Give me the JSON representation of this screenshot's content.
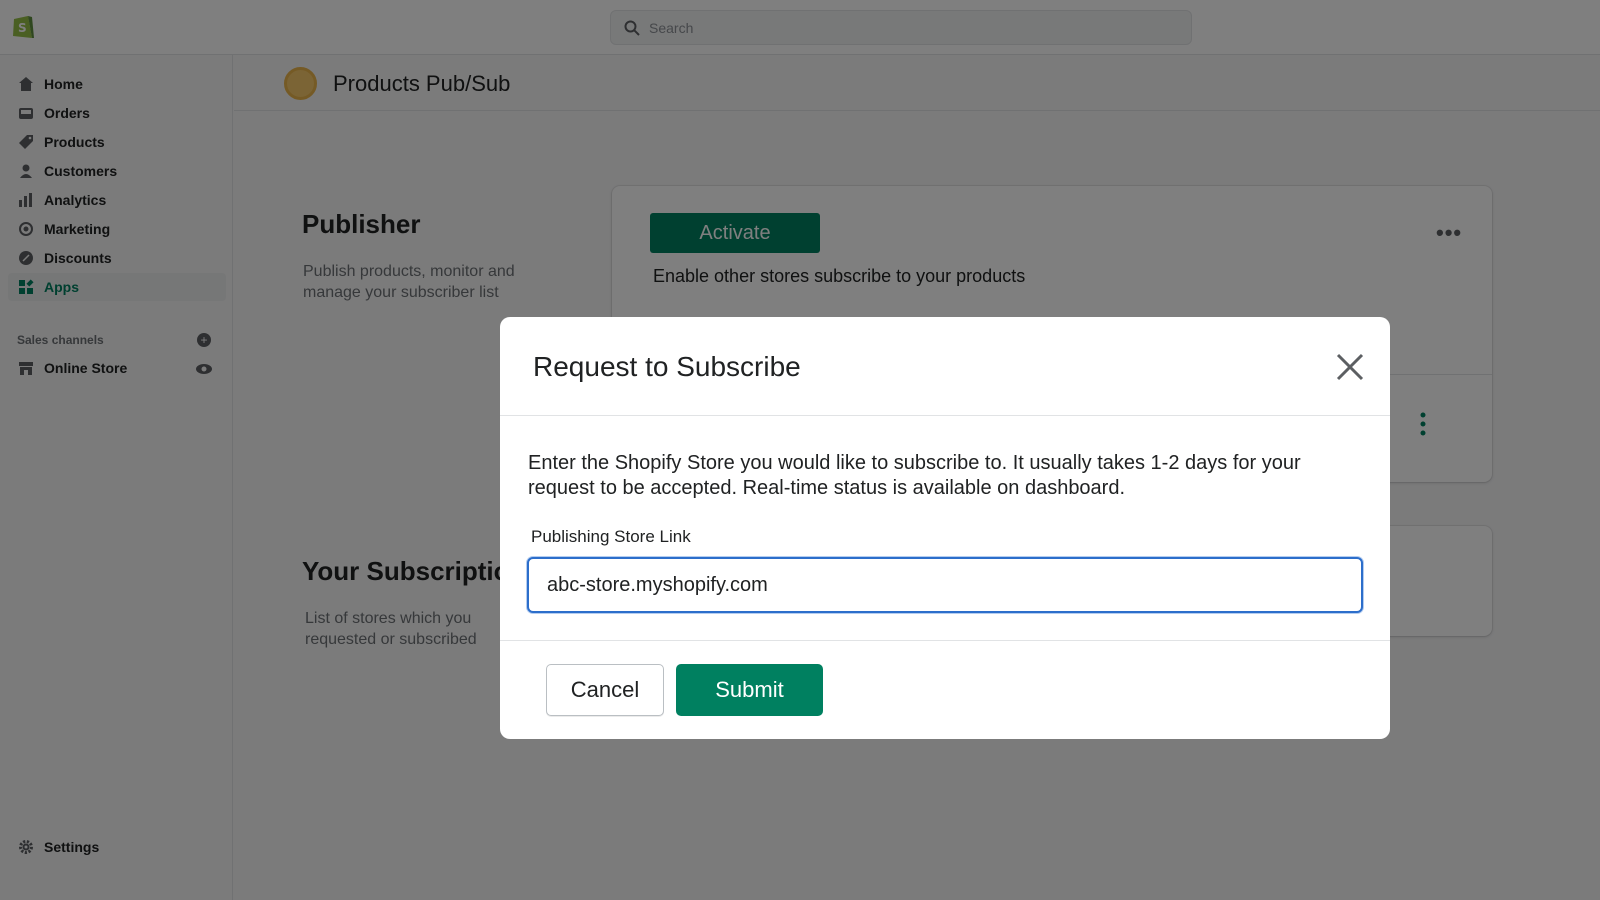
{
  "topbar": {
    "search_placeholder": "Search"
  },
  "sidebar": {
    "items": [
      {
        "label": "Home",
        "icon": "home-icon"
      },
      {
        "label": "Orders",
        "icon": "orders-icon"
      },
      {
        "label": "Products",
        "icon": "tag-icon"
      },
      {
        "label": "Customers",
        "icon": "person-icon"
      },
      {
        "label": "Analytics",
        "icon": "bar-chart-icon"
      },
      {
        "label": "Marketing",
        "icon": "target-icon"
      },
      {
        "label": "Discounts",
        "icon": "discount-icon"
      },
      {
        "label": "Apps",
        "icon": "apps-icon",
        "active": true
      }
    ],
    "sales_channels_label": "Sales channels",
    "online_store_label": "Online Store",
    "settings_label": "Settings"
  },
  "app": {
    "title": "Products Pub/Sub"
  },
  "publisher": {
    "title": "Publisher",
    "description": "Publish products, monitor and manage your subscriber list",
    "activate_label": "Activate",
    "enable_text": "Enable other stores subscribe to your products"
  },
  "subscriptions": {
    "title": "Your Subscriptions",
    "description": "List of stores which you requested or subscribed"
  },
  "modal": {
    "title": "Request to Subscribe",
    "body": "Enter the Shopify Store you would like to subscribe to. It usually takes 1-2 days for your request to be accepted. Real-time status is available on dashboard.",
    "field_label": "Publishing Store Link",
    "field_value": "abc-store.myshopify.com",
    "cancel_label": "Cancel",
    "submit_label": "Submit"
  },
  "colors": {
    "primary": "#008060",
    "focus": "#2c6ecb",
    "background": "#f6f6f7"
  }
}
